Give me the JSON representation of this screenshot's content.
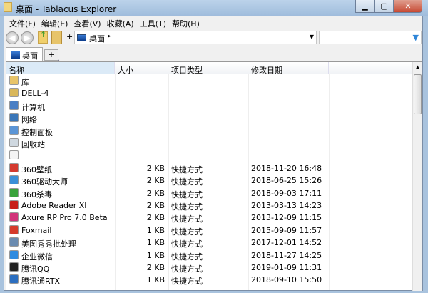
{
  "window": {
    "title": "桌面 - Tablacus Explorer",
    "minimize": "▁",
    "maximize": "▢",
    "close": "✕"
  },
  "menu": [
    "文件(F)",
    "编辑(E)",
    "查看(V)",
    "收藏(A)",
    "工具(T)",
    "帮助(H)"
  ],
  "toolbar": {
    "back": "◀",
    "forward": "▶",
    "plus": "+",
    "address": "桌面",
    "address_arrow": "▸",
    "dropdown": "▼",
    "filter": "▼"
  },
  "tabs": [
    {
      "label": "桌面"
    }
  ],
  "tab_add": "+",
  "columns": [
    "名称",
    "大小",
    "项目类型",
    "修改日期"
  ],
  "sort_indicator": "˄",
  "rows": [
    {
      "name": "库",
      "size": "",
      "type": "",
      "date": "",
      "color": "#e8c468"
    },
    {
      "name": "DELL-4",
      "size": "",
      "type": "",
      "date": "",
      "color": "#d9b75a"
    },
    {
      "name": "计算机",
      "size": "",
      "type": "",
      "date": "",
      "color": "#4a7fc4"
    },
    {
      "name": "网络",
      "size": "",
      "type": "",
      "date": "",
      "color": "#3a76b8"
    },
    {
      "name": "控制面板",
      "size": "",
      "type": "",
      "date": "",
      "color": "#5b95d6"
    },
    {
      "name": "回收站",
      "size": "",
      "type": "",
      "date": "",
      "color": "#cfd8e0"
    },
    {
      "name": "",
      "size": "",
      "type": "",
      "date": "",
      "color": "#f4f4f4"
    },
    {
      "name": "360壁纸",
      "size": "2 KB",
      "type": "快捷方式",
      "date": "2018-11-20 16:48",
      "color": "#d43a2f"
    },
    {
      "name": "360驱动大师",
      "size": "2 KB",
      "type": "快捷方式",
      "date": "2018-06-25 15:26",
      "color": "#3a8fd8"
    },
    {
      "name": "360杀毒",
      "size": "2 KB",
      "type": "快捷方式",
      "date": "2018-09-03 17:11",
      "color": "#39a23b"
    },
    {
      "name": "Adobe Reader XI",
      "size": "2 KB",
      "type": "快捷方式",
      "date": "2013-03-13 14:23",
      "color": "#c8201a"
    },
    {
      "name": "Axure RP Pro 7.0 Beta",
      "size": "2 KB",
      "type": "快捷方式",
      "date": "2013-12-09 11:15",
      "color": "#d2337a"
    },
    {
      "name": "Foxmail",
      "size": "1 KB",
      "type": "快捷方式",
      "date": "2015-09-09 11:57",
      "color": "#d63a2a"
    },
    {
      "name": "美图秀秀批处理",
      "size": "1 KB",
      "type": "快捷方式",
      "date": "2017-12-01 14:52",
      "color": "#6a8bb0"
    },
    {
      "name": "企业微信",
      "size": "1 KB",
      "type": "快捷方式",
      "date": "2018-11-27 14:25",
      "color": "#2f8be0"
    },
    {
      "name": "腾讯QQ",
      "size": "2 KB",
      "type": "快捷方式",
      "date": "2019-01-09 11:31",
      "color": "#222222"
    },
    {
      "name": "腾讯通RTX",
      "size": "1 KB",
      "type": "快捷方式",
      "date": "2018-09-10 15:50",
      "color": "#2c6fc0"
    }
  ],
  "scroll": {
    "up": "▲"
  }
}
